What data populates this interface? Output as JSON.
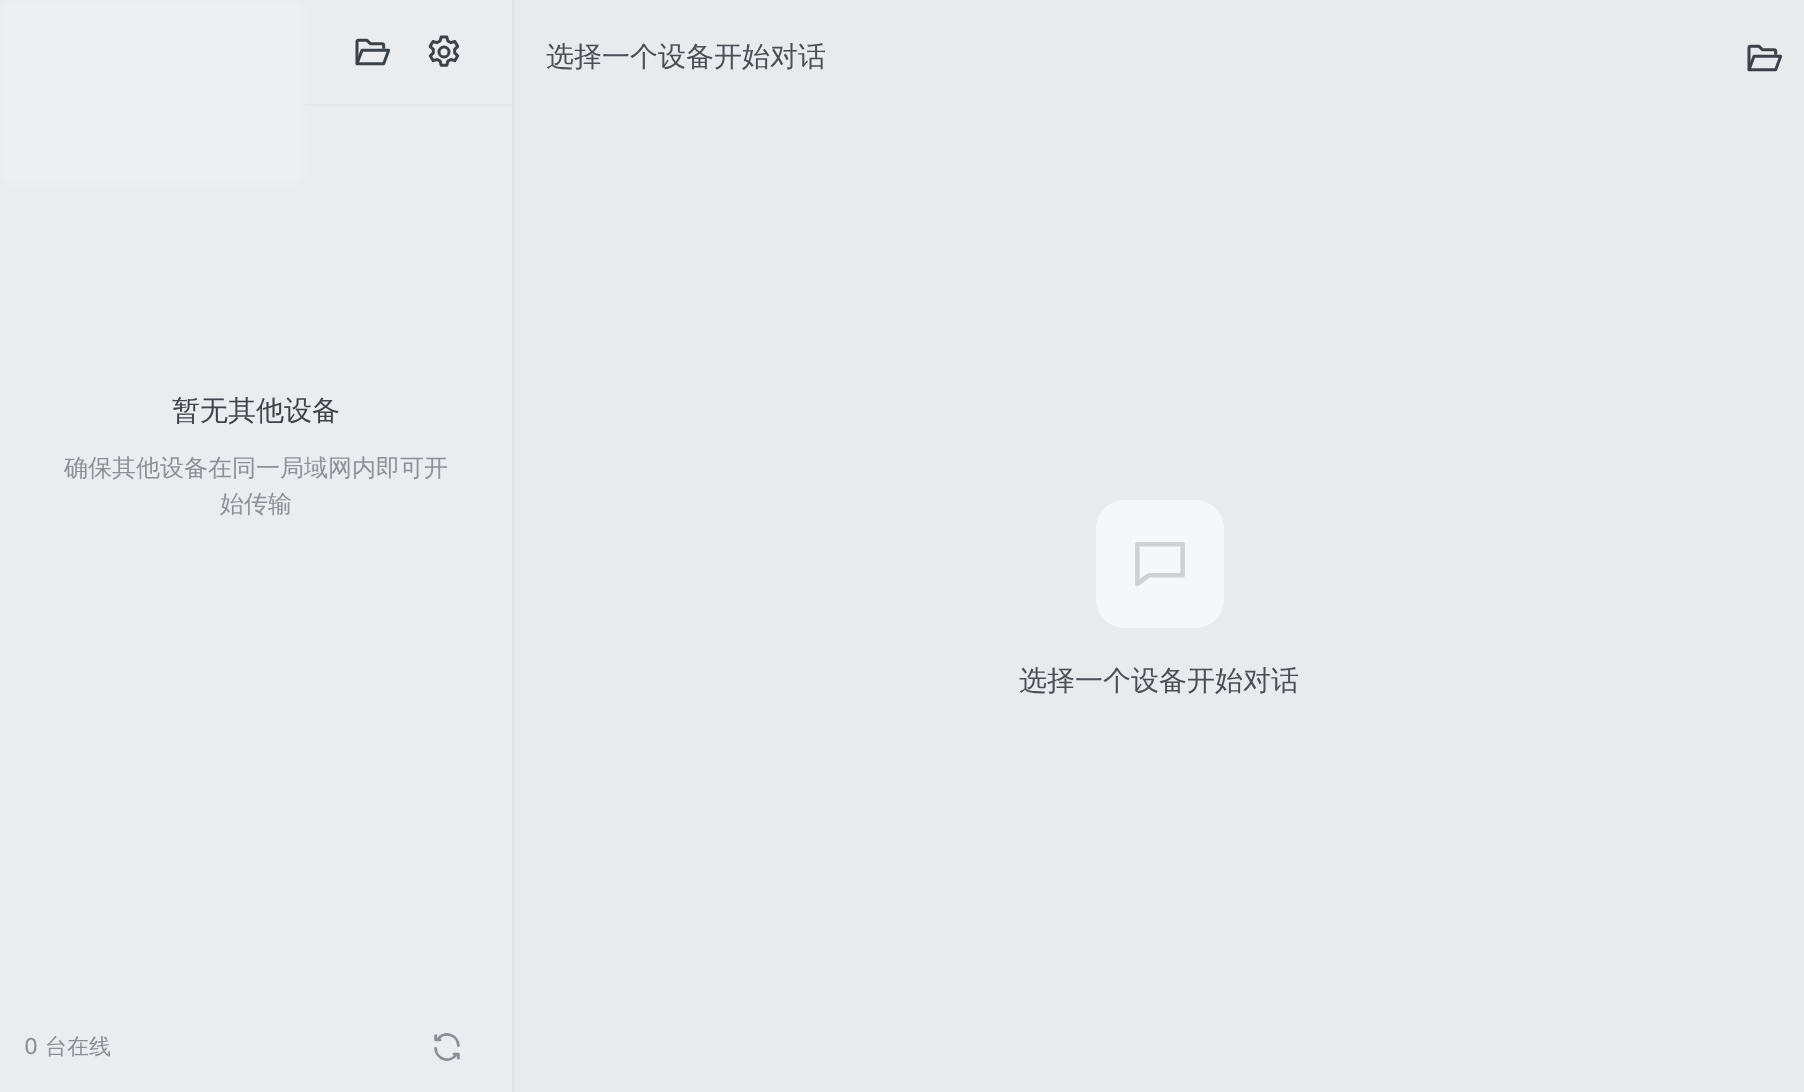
{
  "sidebar": {
    "empty_title": "暂无其他设备",
    "empty_hint": "确保其他设备在同一局域网内即可开始传输",
    "online_count": "0 台在线"
  },
  "main": {
    "title": "选择一个设备开始对话",
    "empty_text": "选择一个设备开始对话"
  }
}
